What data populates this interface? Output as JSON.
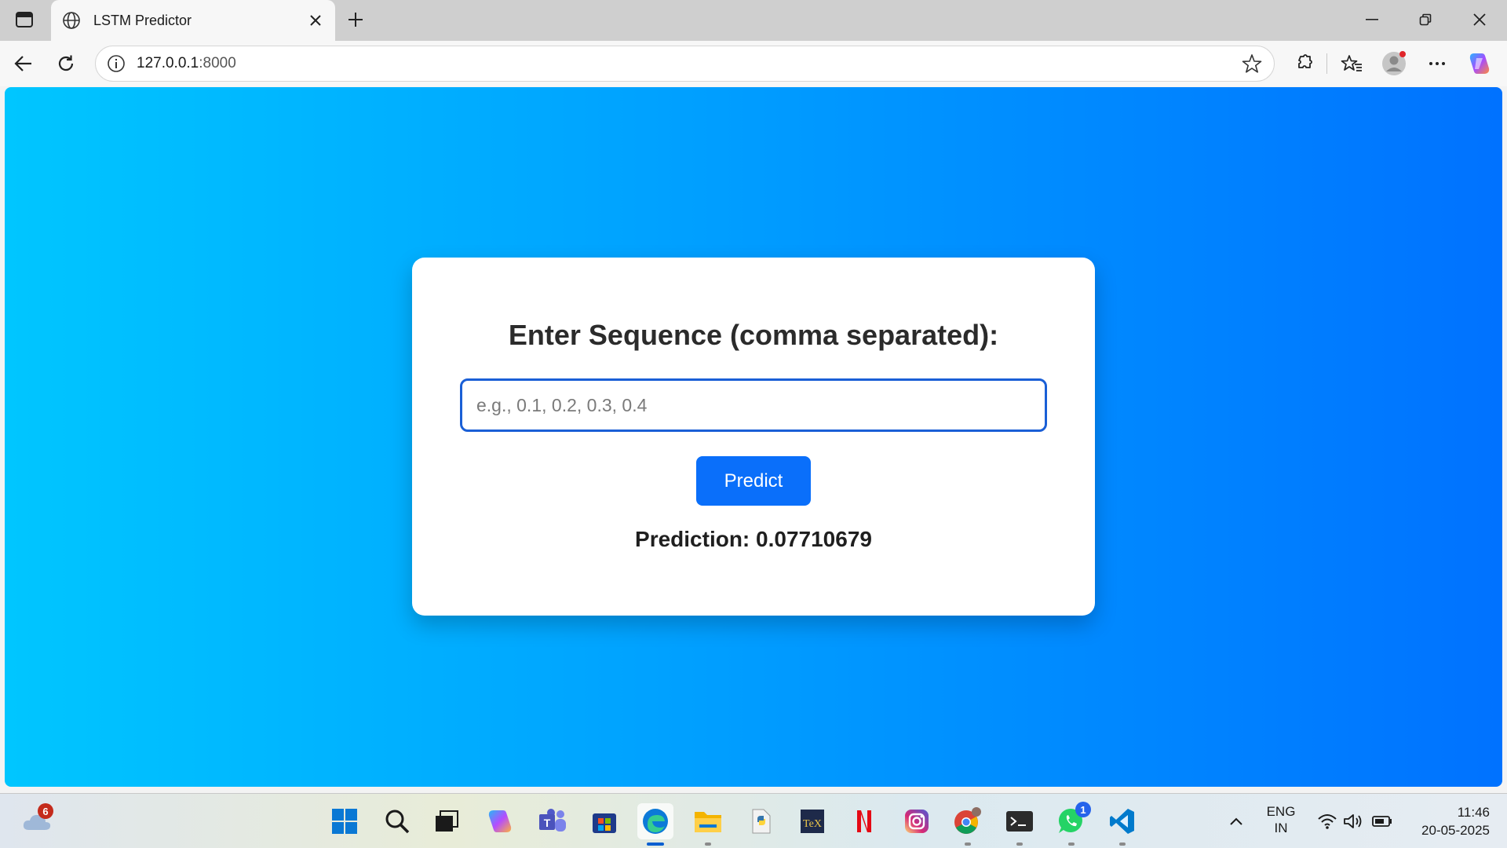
{
  "browser": {
    "tab": {
      "title": "LSTM Predictor"
    },
    "url": {
      "host": "127.0.0.1",
      "port": ":8000"
    }
  },
  "page": {
    "heading": "Enter Sequence (comma separated):",
    "input": {
      "placeholder": "e.g., 0.1, 0.2, 0.3, 0.4",
      "value": ""
    },
    "predict_label": "Predict",
    "result": "Prediction: 0.07710679",
    "colors": {
      "gradient_start": "#00c6ff",
      "gradient_end": "#0072ff",
      "button": "#0a6ffa"
    }
  },
  "taskbar": {
    "weather_badge": "6",
    "whatsapp_badge": "1",
    "lang": {
      "line1": "ENG",
      "line2": "IN"
    },
    "clock": {
      "time": "11:46",
      "date": "20-05-2025"
    },
    "apps": [
      "start-icon",
      "search-icon",
      "task-view-icon",
      "copilot-icon",
      "teams-icon",
      "store-icon",
      "edge-icon",
      "file-explorer-icon",
      "python-icon",
      "texstudio-icon",
      "netflix-icon",
      "instagram-icon",
      "chrome-icon",
      "terminal-icon",
      "whatsapp-icon",
      "vscode-icon"
    ]
  }
}
